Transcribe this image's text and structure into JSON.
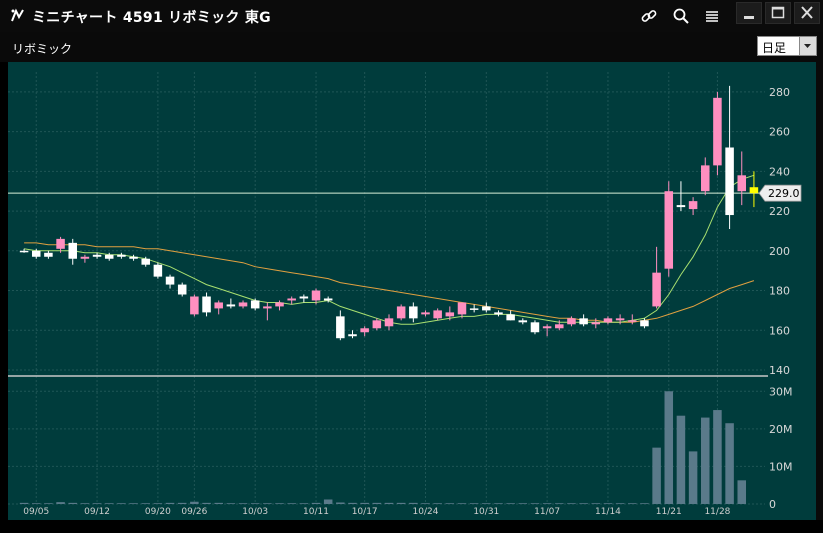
{
  "window": {
    "title": "ミニチャート 4591 リボミック 東G",
    "icons": [
      "link-icon",
      "search-icon",
      "menu-icon",
      "minimize-icon",
      "maximize-icon",
      "close-icon"
    ]
  },
  "toolbar": {
    "symbol_label": "リボミック",
    "period_value": "日足"
  },
  "colors": {
    "background": "#003c3c",
    "up_candle": "#ff8fc0",
    "down_candle": "#ffffff",
    "last_candle": "#ffff00",
    "ma_short": "#a8e070",
    "ma_long": "#e0a040",
    "volume": "#5a7a8a",
    "price_line": "#d8f0d8"
  },
  "price_marker": {
    "label": "229.0",
    "value": 229
  },
  "chart_data": [
    {
      "type": "candlestick",
      "y_axis_ticks": [
        {
          "value": 280,
          "label": "280"
        },
        {
          "value": 260,
          "label": "260"
        },
        {
          "value": 240,
          "label": "240"
        },
        {
          "value": 220,
          "label": "220"
        },
        {
          "value": 200,
          "label": "200"
        },
        {
          "value": 180,
          "label": "180"
        },
        {
          "value": 160,
          "label": "160"
        },
        {
          "value": 140,
          "label": "140"
        }
      ],
      "ylim": [
        140,
        290
      ],
      "x_labels": [
        {
          "index": 1,
          "label": "09/05"
        },
        {
          "index": 6,
          "label": "09/12"
        },
        {
          "index": 11,
          "label": "09/20"
        },
        {
          "index": 14,
          "label": "09/26"
        },
        {
          "index": 19,
          "label": "10/03"
        },
        {
          "index": 24,
          "label": "10/11"
        },
        {
          "index": 28,
          "label": "10/17"
        },
        {
          "index": 33,
          "label": "10/24"
        },
        {
          "index": 38,
          "label": "10/31"
        },
        {
          "index": 43,
          "label": "11/07"
        },
        {
          "index": 48,
          "label": "11/14"
        },
        {
          "index": 53,
          "label": "11/21"
        },
        {
          "index": 57,
          "label": "11/28"
        }
      ],
      "candles": [
        [
          200,
          201,
          199,
          200
        ],
        [
          200,
          201,
          196,
          197
        ],
        [
          197,
          200,
          196,
          199
        ],
        [
          201,
          207,
          199,
          206
        ],
        [
          204,
          206,
          193,
          196
        ],
        [
          196,
          198,
          194,
          197
        ],
        [
          197,
          199,
          196,
          198
        ],
        [
          198,
          199,
          195,
          196
        ],
        [
          198,
          199,
          196,
          197
        ],
        [
          197,
          198,
          195,
          196
        ],
        [
          196,
          197,
          192,
          193
        ],
        [
          193,
          194,
          186,
          187
        ],
        [
          187,
          188,
          181,
          183
        ],
        [
          183,
          184,
          177,
          178
        ],
        [
          168,
          178,
          167,
          177
        ],
        [
          177,
          179,
          167,
          169
        ],
        [
          171,
          175,
          168,
          174
        ],
        [
          173,
          176,
          171,
          172
        ],
        [
          172,
          175,
          171,
          174
        ],
        [
          175,
          176,
          170,
          171
        ],
        [
          171,
          174,
          165,
          172
        ],
        [
          172,
          175,
          170,
          174
        ],
        [
          175,
          177,
          173,
          176
        ],
        [
          176,
          178,
          174,
          177
        ],
        [
          175,
          181,
          173,
          180
        ],
        [
          176,
          177,
          174,
          175
        ],
        [
          167,
          170,
          155,
          156
        ],
        [
          157,
          160,
          156,
          158
        ],
        [
          159,
          162,
          157,
          161
        ],
        [
          161,
          166,
          160,
          165
        ],
        [
          162,
          168,
          160,
          166
        ],
        [
          166,
          173,
          165,
          172
        ],
        [
          172,
          174,
          164,
          166
        ],
        [
          168,
          170,
          167,
          169
        ],
        [
          166,
          171,
          165,
          170
        ],
        [
          169,
          172,
          165,
          167
        ],
        [
          168,
          174,
          166,
          174
        ],
        [
          171,
          173,
          169,
          171
        ],
        [
          170,
          174,
          169,
          172
        ],
        [
          168,
          170,
          167,
          169
        ],
        [
          168,
          170,
          165,
          165
        ],
        [
          165,
          166,
          163,
          164
        ],
        [
          164,
          165,
          158,
          159
        ],
        [
          161,
          163,
          157,
          162
        ],
        [
          161,
          165,
          160,
          163
        ],
        [
          163,
          167,
          162,
          166
        ],
        [
          166,
          168,
          162,
          163
        ],
        [
          163,
          166,
          161,
          164
        ],
        [
          164,
          167,
          163,
          166
        ],
        [
          165,
          168,
          163,
          166
        ],
        [
          165,
          168,
          163,
          165
        ],
        [
          165,
          166,
          161,
          162
        ],
        [
          172,
          202,
          171,
          189
        ],
        [
          191,
          235,
          187,
          230
        ],
        [
          223,
          235,
          220,
          222
        ],
        [
          221,
          227,
          218,
          225
        ],
        [
          230,
          247,
          228,
          243
        ],
        [
          243,
          280,
          238,
          277
        ],
        [
          252,
          283,
          211,
          218
        ],
        [
          230,
          250,
          223,
          238
        ],
        [
          232,
          240,
          222,
          229
        ]
      ],
      "candle_colors": [
        "white",
        "white",
        "white",
        "pink",
        "white",
        "pink",
        "white",
        "white",
        "white",
        "white",
        "white",
        "white",
        "white",
        "white",
        "pink",
        "white",
        "pink",
        "white",
        "pink",
        "white",
        "pink",
        "pink",
        "pink",
        "white",
        "pink",
        "white",
        "white",
        "white",
        "pink",
        "pink",
        "pink",
        "pink",
        "white",
        "pink",
        "pink",
        "pink",
        "pink",
        "white",
        "white",
        "white",
        "white",
        "white",
        "white",
        "pink",
        "pink",
        "pink",
        "white",
        "pink",
        "pink",
        "pink",
        "pink",
        "white",
        "pink",
        "pink",
        "white",
        "pink",
        "pink",
        "pink",
        "white",
        "pink",
        "yellow"
      ],
      "ma_short": [
        201,
        200,
        200,
        200,
        200,
        199,
        199,
        198,
        198,
        197,
        196,
        194,
        192,
        189,
        186,
        183,
        181,
        179,
        177,
        175,
        174,
        174,
        173,
        174,
        174,
        175,
        172,
        170,
        168,
        166,
        164,
        163,
        163,
        164,
        165,
        166,
        167,
        167,
        168,
        168,
        168,
        167,
        166,
        165,
        164,
        164,
        164,
        164,
        164,
        164,
        165,
        166,
        170,
        178,
        188,
        197,
        208,
        222,
        232,
        236,
        238
      ],
      "ma_long": [
        204,
        204,
        203,
        203,
        203,
        203,
        202,
        202,
        202,
        202,
        201,
        201,
        200,
        199,
        198,
        197,
        196,
        195,
        194,
        192,
        191,
        190,
        189,
        188,
        187,
        186,
        184,
        183,
        182,
        181,
        180,
        179,
        178,
        177,
        176,
        175,
        174,
        173,
        172,
        171,
        170,
        169,
        168,
        167,
        166,
        166,
        165,
        165,
        164,
        164,
        164,
        165,
        166,
        168,
        170,
        172,
        175,
        178,
        181,
        183,
        185
      ],
      "volume_axis_ticks": [
        {
          "value": 0,
          "label": "0"
        },
        {
          "value": 10,
          "label": "10M"
        },
        {
          "value": 20,
          "label": "20M"
        },
        {
          "value": 30,
          "label": "30M"
        }
      ],
      "volume": [
        0.3,
        0.2,
        0.2,
        0.5,
        0.3,
        0.2,
        0.2,
        0.2,
        0.2,
        0.2,
        0.2,
        0.2,
        0.3,
        0.3,
        0.6,
        0.3,
        0.3,
        0.2,
        0.2,
        0.2,
        0.2,
        0.2,
        0.2,
        0.2,
        0.3,
        1.2,
        0.4,
        0.3,
        0.3,
        0.3,
        0.3,
        0.3,
        0.3,
        0.2,
        0.2,
        0.2,
        0.2,
        0.2,
        0.2,
        0.2,
        0.2,
        0.2,
        0.2,
        0.2,
        0.2,
        0.2,
        0.2,
        0.2,
        0.2,
        0.2,
        0.2,
        0.2,
        15,
        30,
        23.5,
        14,
        23,
        25,
        21.5,
        6.3,
        0
      ],
      "volume_ylim": [
        0,
        33
      ]
    }
  ]
}
